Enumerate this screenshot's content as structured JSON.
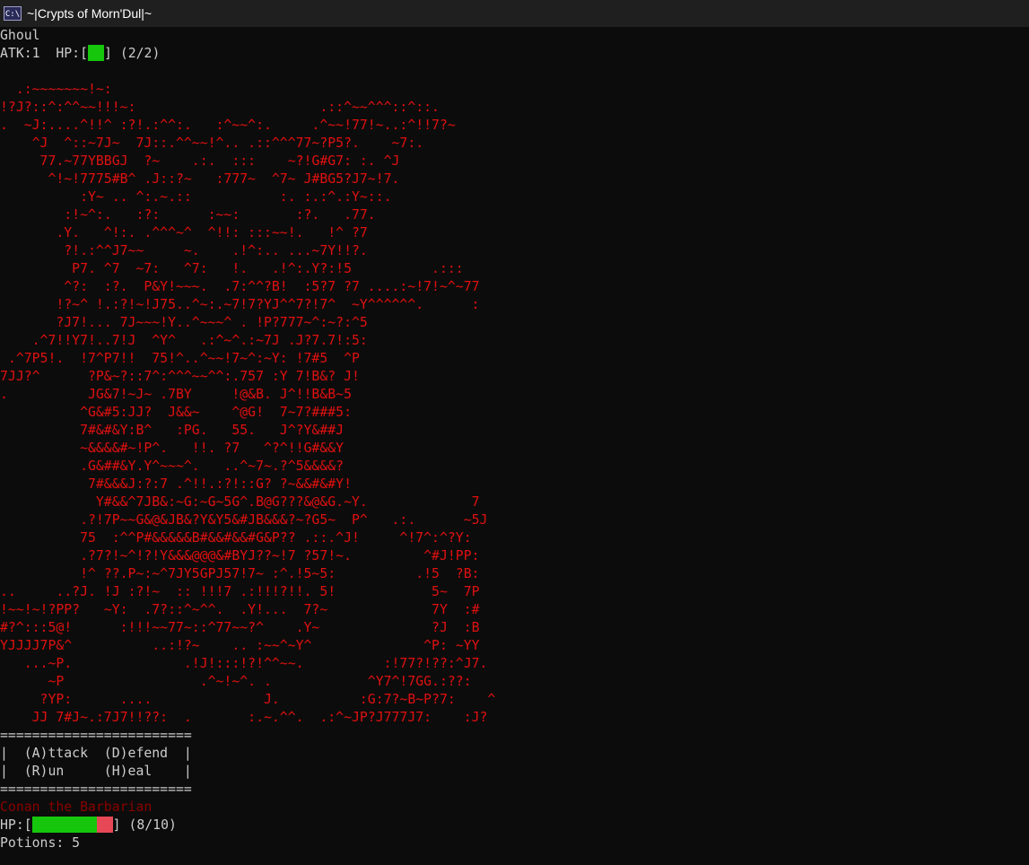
{
  "window": {
    "icon_label": "C:\\",
    "title": "~|Crypts of Morn'Dul|~"
  },
  "enemy": {
    "name": "Ghoul",
    "atk_label": "ATK:1  HP:[",
    "hp_suffix": "] (2/2)",
    "hp_current": 2,
    "hp_max": 2
  },
  "art_lines": [
    "",
    "  .:~~~~~~~!~:",
    "!?J?::^:^^~~!!!~:                       .::^~~^^^::^::.",
    ".  ~J:....^!!^ :?!.:^^:.   :^~~^:.     .^~~!77!~..:^!!7?~",
    "    ^J  ^::~7J~  7J::.^^~~!^.. .::^^^77~?P5?.    ~7:.",
    "     77.~77YBBGJ  ?~    .:.  :::    ~?!G#G7: :. ^J",
    "      ^!~!7775#B^ .J::?~   :777~  ^7~ J#BG5?J7~!7.",
    "          :Y~ .. ^:.~.::           :. :.:^.:Y~::.",
    "        :!~^:.   :?:      :~~:       :?.   .77.",
    "       .Y.   ^!:. .^^^~^  ^!!: :::~~!.   !^ ?7",
    "        ?!.:^^J7~~     ~.    .!^:.. ...~7Y!!?.",
    "         P7. ^7  ~7:   ^7:   !.   .!^:.Y?:!5          .:::",
    "        ^?:  :?.  P&Y!~~~.  .7:^^?B!  :5?7 ?7 ....:~!7!~^~77",
    "       !?~^ !.:?!~!J75..^~:.~7!7?YJ^^7?!7^  ~Y^^^^^^.      :",
    "       ?J7!... 7J~~~!Y..^~~~^ . !P?777~^:~?:^5",
    "    .^7!!Y7!..7!J  ^Y^   .:^~^.:~7J .J?7.7!:5:",
    " .^7P5!.  !7^P7!!  75!^..^~~!7~^:~Y: !7#5  ^P",
    "7JJ?^      ?P&~?::7^:^^^~~^^:.757 :Y 7!B&? J!",
    ".          JG&7!~J~ .7BY     !@&B. J^!!B&B~5",
    "          ^G&#5:JJ?  J&&~    ^@G!  7~7?###5:",
    "          7#&#&Y:B^   :PG.   55.   J^?Y&##J",
    "          ~&&&&#~!P^.   !!. ?7   ^?^!!G#&&Y",
    "          .G&##&Y.Y^~~~^.   ..^~7~.?^5&&&&?",
    "           7#&&&J:?:7 .^!!.:?!::G? ?~&&#&#Y!",
    "            Y#&&^7JB&:~G:~G~5G^.B@G???&@&G.~Y.             7",
    "          .?!7P~~G&@&JB&?Y&Y5&#JB&&&?~?G5~  P^   .:.      ~5J",
    "          75  :^^P#&&&&&B#&&#&&#G&P?? .::.^J!     ^!7^:^?Y:",
    "          .?7?!~^!?!Y&&&@@@&#BYJ??~!7 ?57!~.         ^#J!PP:",
    "          !^ ??.P~:~^7JY5GPJ57!7~ :^.!5~5:          .!5  ?B:",
    "..     ..?J. !J :?!~  :: !!!7 .:!!!?!!. 5!            5~  7P",
    "!~~!~!?PP?   ~Y:  .7?::^~^^.  .Y!...  7?~             7Y  :#",
    "#?^:::5@!      :!!!~~77~::^77~~?^    .Y~              ?J  :B",
    "YJJJJ7P&^          ..:!?~    .. :~~^~Y^              ^P: ~YY",
    "   ...~P.              .!J!:::!?!^^~~.          :!77?!??:^J7.",
    "      ~P                 .^~!~^. .            ^Y7^!7GG.:??:",
    "     ?YP:      ....              J.          :G:7?~B~P?7:    ^",
    "    JJ 7#J~.:7J7!!??:  .       :.~.^^.  .:^~JP?J777J7:    :J?"
  ],
  "menu": {
    "rule": "========================",
    "row1": "|  (A)ttack  (D)efend  |",
    "row2": "|  (R)un     (H)eal    |"
  },
  "player": {
    "name": "Conan the Barbarian",
    "hp_label": "HP:[",
    "hp_suffix": "] (8/10)",
    "hp_current": 8,
    "hp_max": 10,
    "potions_text": "Potions: 5"
  },
  "colors": {
    "background": "#0c0c0c",
    "text": "#cccccc",
    "art": "#e01010",
    "hp_green": "#16c60c",
    "hp_missing": "#e74856",
    "player_name": "#8b0000"
  }
}
